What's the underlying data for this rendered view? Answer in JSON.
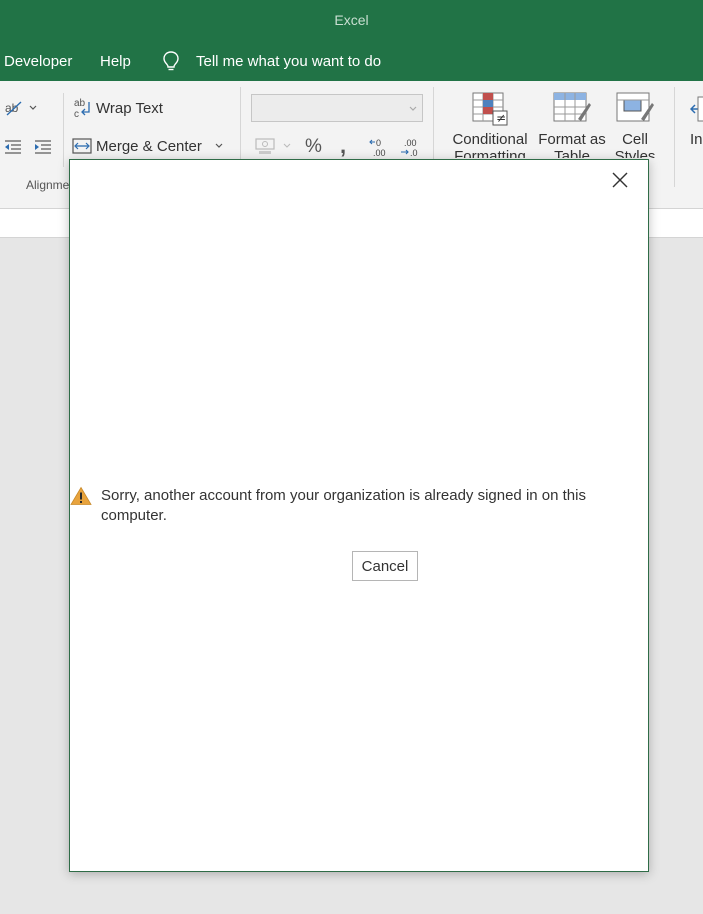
{
  "app": {
    "title": "Excel"
  },
  "tabs": [
    {
      "label": "Developer"
    },
    {
      "label": "Help"
    }
  ],
  "tell_me": {
    "placeholder": "Tell me what you want to do"
  },
  "ribbon": {
    "alignment": {
      "wrap_text": "Wrap Text",
      "merge_center": "Merge & Center",
      "group_label": "Alignme"
    },
    "number": {
      "format_value": "",
      "percent": "%",
      "comma": ","
    },
    "styles": {
      "conditional_formatting_line1": "Conditional",
      "conditional_formatting_line2": "Formatting",
      "format_as_table_line1": "Format as",
      "format_as_table_line2": "Table",
      "cell_styles_line1": "Cell",
      "cell_styles_line2": "Styles"
    },
    "cells": {
      "insert_partial": "In"
    }
  },
  "dialog": {
    "message": "Sorry, another account from your organization is already signed in on this computer.",
    "cancel_label": "Cancel"
  },
  "icons": {
    "close": "close-icon",
    "warning": "warning-icon",
    "lightbulb": "lightbulb-icon"
  },
  "colors": {
    "titlebar": "#217346",
    "ribbon": "#f3f3f3",
    "workspace": "#e6e6e6",
    "dialog_border": "#2f6c47",
    "warning": "#e8a33d"
  }
}
